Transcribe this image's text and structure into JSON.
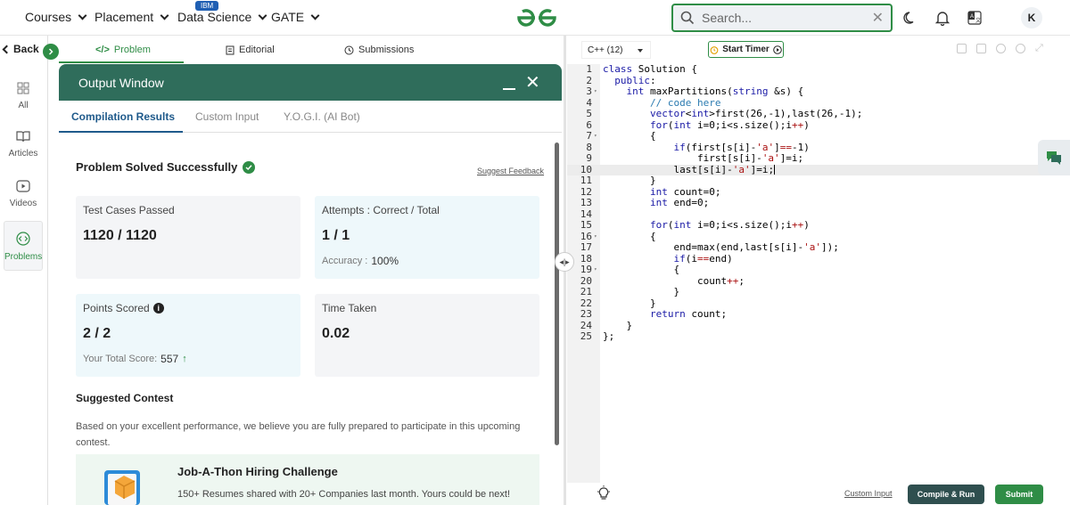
{
  "nav": {
    "items": [
      "Courses",
      "Placement",
      "Data Science",
      "GATE"
    ],
    "ibm_badge": "IBM",
    "search_placeholder": "Search...",
    "avatar": "K",
    "brand_color": "#2f8d46"
  },
  "sidebar": {
    "back": "Back",
    "items": [
      {
        "label": "All",
        "icon": "grid-icon"
      },
      {
        "label": "Articles",
        "icon": "book-icon"
      },
      {
        "label": "Videos",
        "icon": "play-icon"
      },
      {
        "label": "Problems",
        "icon": "code-icon"
      }
    ]
  },
  "problem_tabs": [
    "Problem",
    "Editorial",
    "Submissions"
  ],
  "output": {
    "title": "Output Window",
    "tabs": [
      "Compilation Results",
      "Custom Input",
      "Y.O.G.I. (AI Bot)"
    ],
    "status": "Problem Solved Successfully",
    "feedback": "Suggest Feedback",
    "cards": {
      "tests": {
        "title": "Test Cases Passed",
        "value": "1120 / 1120"
      },
      "attempts": {
        "title": "Attempts : Correct / Total",
        "value": "1 / 1",
        "sub_label": "Accuracy :",
        "sub_value": "100%"
      },
      "points": {
        "title": "Points Scored",
        "value": "2 / 2",
        "sub_label": "Your Total Score:",
        "sub_value": "557"
      },
      "time": {
        "title": "Time Taken",
        "value": "0.02"
      }
    },
    "suggested": {
      "title": "Suggested Contest",
      "text": "Based on your excellent performance, we believe you are fully prepared to participate in this upcoming contest.",
      "contest_title": "Job-A-Thon Hiring Challenge",
      "contest_desc": "150+ Resumes shared with 20+ Companies last month. Yours could be next!"
    }
  },
  "editor": {
    "language": "C++ (12)",
    "timer": "Start Timer",
    "custom_input": "Custom Input",
    "compile": "Compile & Run",
    "submit": "Submit",
    "code_lines": [
      "class Solution {",
      "  public:",
      "    int maxPartitions(string &s) {",
      "        // code here",
      "        vector<int>first(26,-1),last(26,-1);",
      "        for(int i=0;i<s.size();i++)",
      "        {",
      "            if(first[s[i]-'a']==-1)",
      "                first[s[i]-'a']=i;",
      "            last[s[i]-'a']=i;",
      "        }",
      "        int count=0;",
      "        int end=0;",
      "",
      "        for(int i=0;i<s.size();i++)",
      "        {",
      "            end=max(end,last[s[i]-'a']);",
      "            if(i==end)",
      "            {",
      "                count++;",
      "            }",
      "        }",
      "        return count;",
      "    }",
      "};"
    ],
    "fold_lines": [
      3,
      7,
      16,
      19
    ],
    "highlight_line": 10
  }
}
